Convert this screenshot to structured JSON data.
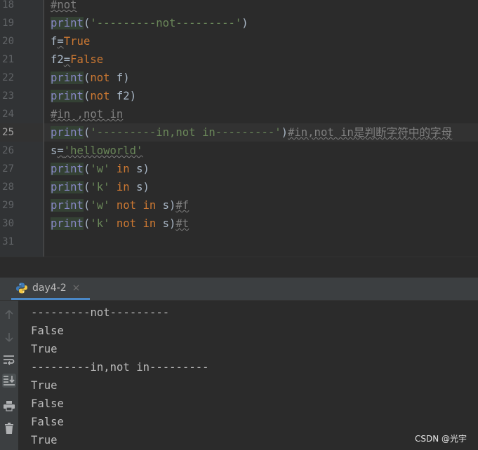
{
  "editor": {
    "lines": [
      {
        "num": "18",
        "text": "#not"
      },
      {
        "num": "19",
        "text": "print('---------not---------')"
      },
      {
        "num": "20",
        "text": "f=True"
      },
      {
        "num": "21",
        "text": "f2=False"
      },
      {
        "num": "22",
        "text": "print(not f)"
      },
      {
        "num": "23",
        "text": "print(not f2)"
      },
      {
        "num": "24",
        "text": "#in ,not in"
      },
      {
        "num": "25",
        "text": "print('---------in,not in---------')#in,not in是判断字符中的字母"
      },
      {
        "num": "26",
        "text": "s='helloworld'"
      },
      {
        "num": "27",
        "text": "print('w' in s)"
      },
      {
        "num": "28",
        "text": "print('k' in s)"
      },
      {
        "num": "29",
        "text": "print('w' not in s)#f"
      },
      {
        "num": "30",
        "text": "print('k' not in s)#t"
      },
      {
        "num": "31",
        "text": ""
      }
    ],
    "current_line": "25",
    "tokens": {
      "print": "print",
      "not": "not",
      "in": "in",
      "True": "True",
      "False": "False",
      "f": "f",
      "f2": "f2",
      "s": "s",
      "eq": "=",
      "lparen": "(",
      "rparen": ")",
      "space": " ",
      "c18": "#not",
      "s19": "'---------not---------'",
      "c24": "#in ,not in",
      "s25": "'---------in,not in---------'",
      "c25": "#in,not in是判断字符中的字母",
      "s26": "'helloworld'",
      "sw": "'w'",
      "sk": "'k'",
      "c29": "#f",
      "c30": "#t"
    }
  },
  "run_panel": {
    "tab_label": "day4-2",
    "tab_close": "×",
    "output": [
      "---------not---------",
      "False",
      "True",
      "---------in,not in---------",
      "True",
      "False",
      "False",
      "True"
    ],
    "tools": [
      "up-arrow-icon",
      "down-arrow-icon",
      "soft-wrap-icon",
      "scroll-to-end-icon",
      "print-icon",
      "trash-icon"
    ]
  },
  "watermark": "CSDN @光宇",
  "colors": {
    "keyword": "#cc7832",
    "builtin": "#8888c6",
    "string": "#6a8759",
    "comment": "#808080",
    "text": "#a9b7c6",
    "tab_underline": "#4a88c7"
  }
}
